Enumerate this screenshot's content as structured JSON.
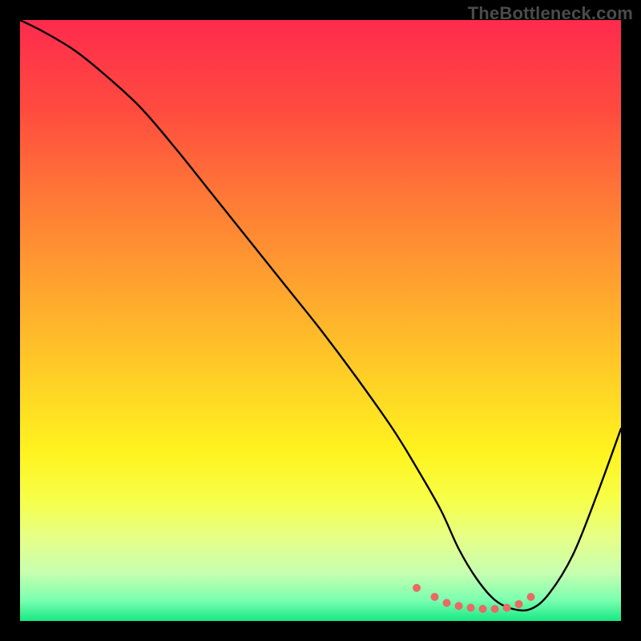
{
  "watermark": "TheBottleneck.com",
  "chart_data": {
    "type": "line",
    "title": "",
    "xlabel": "",
    "ylabel": "",
    "xlim": [
      0,
      100
    ],
    "ylim": [
      0,
      100
    ],
    "grid": false,
    "legend": false,
    "background_gradient": {
      "stops": [
        {
          "offset": 0.0,
          "color": "#ff2b4d"
        },
        {
          "offset": 0.15,
          "color": "#ff4b3f"
        },
        {
          "offset": 0.3,
          "color": "#ff7a36"
        },
        {
          "offset": 0.45,
          "color": "#ffa52e"
        },
        {
          "offset": 0.6,
          "color": "#ffd126"
        },
        {
          "offset": 0.72,
          "color": "#fff31f"
        },
        {
          "offset": 0.8,
          "color": "#f6ff4a"
        },
        {
          "offset": 0.86,
          "color": "#e7ff86"
        },
        {
          "offset": 0.92,
          "color": "#c7ffb0"
        },
        {
          "offset": 0.965,
          "color": "#7bffb0"
        },
        {
          "offset": 1.0,
          "color": "#18e884"
        }
      ]
    },
    "series": [
      {
        "name": "bottleneck-curve",
        "color": "#000000",
        "x": [
          0,
          4,
          9,
          14,
          20,
          26,
          32,
          38,
          44,
          50,
          56,
          62,
          66,
          70,
          73,
          76,
          79,
          82,
          85,
          88,
          92,
          96,
          100
        ],
        "y": [
          100,
          98,
          95,
          91,
          85.5,
          78.5,
          71,
          63.5,
          56,
          48.5,
          40.5,
          32,
          25.5,
          18.5,
          12,
          7,
          3.5,
          2,
          2,
          4.5,
          11,
          21,
          32
        ]
      }
    ],
    "markers": {
      "name": "valley-dots",
      "color": "#ea6a63",
      "radius_px": 5,
      "x": [
        66,
        69,
        71,
        73,
        75,
        77,
        79,
        81,
        83,
        85
      ],
      "y": [
        5.5,
        4,
        3,
        2.5,
        2.2,
        2,
        2,
        2.2,
        2.8,
        4
      ]
    }
  }
}
